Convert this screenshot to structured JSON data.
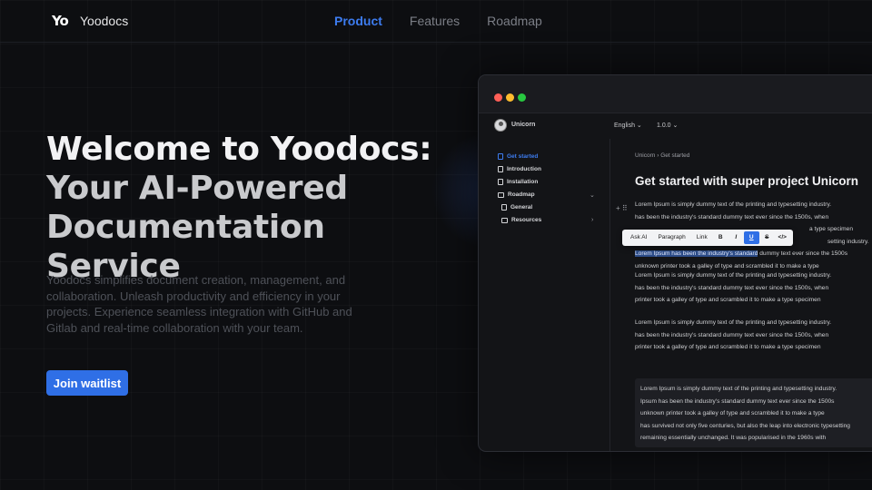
{
  "header": {
    "logo_mark": "Yo",
    "brand": "Yoodocs",
    "nav": [
      {
        "label": "Product",
        "active": true
      },
      {
        "label": "Features",
        "active": false
      },
      {
        "label": "Roadmap",
        "active": false
      }
    ]
  },
  "hero": {
    "title_line1": "Welcome to Yoodocs:",
    "title_line2": "Your AI-Powered",
    "title_line3": "Documentation Service",
    "description": "Yoodocs simplifies document creation, management, and collaboration. Unleash productivity and efficiency in your projects. Experience seamless integration with GitHub and Gitlab and real-time collaboration with your team.",
    "cta_label": "Join waitlist"
  },
  "app": {
    "project_name": "Unicorn",
    "language": "English",
    "version": "1.0.0",
    "sidebar": [
      {
        "label": "Get started",
        "icon": "doc-icon",
        "active": true
      },
      {
        "label": "Introduction",
        "icon": "doc-icon"
      },
      {
        "label": "Installation",
        "icon": "doc-icon"
      },
      {
        "label": "Roadmap",
        "icon": "folder-icon",
        "expanded": true
      },
      {
        "label": "General",
        "icon": "doc-icon"
      },
      {
        "label": "Resources",
        "icon": "folder-icon",
        "expanded": false
      }
    ],
    "breadcrumb": [
      "Unicorn",
      "Get started"
    ],
    "doc_title": "Get started with super project Unicorn",
    "para1": [
      "Lorem Ipsum is simply dummy text of the printing and typesetting industry.",
      "has been the industry's standard dummy text ever since the 1500s, when",
      "a type specimen",
      "setting industry."
    ],
    "para1_highlight": "Lorem Ipsum has been the industry's standard",
    "para1_after_highlight": " dummy text ever since the 1500s",
    "para1_last": "unknown printer took a galley of type and scrambled it to make a type",
    "toolbar": {
      "ask_ai": "Ask AI",
      "paragraph": "Paragraph",
      "link": "Link",
      "bold": "B",
      "italic": "I",
      "underline": "U",
      "strike": "S",
      "code": "</>"
    },
    "para2": [
      "Lorem Ipsum is simply dummy text of the printing and typesetting industry.",
      "has been the industry's standard dummy text ever since the 1500s, when",
      "printer took a galley of type and scrambled it to make a type specimen"
    ],
    "para3": [
      "Lorem Ipsum is simply dummy text of the printing and typesetting industry.",
      "has been the industry's standard dummy text ever since the 1500s, when",
      "printer took a galley of type and scrambled it to make a type specimen"
    ],
    "quote": [
      "Lorem Ipsum is simply dummy text of the printing and typesetting industry.",
      "Ipsum has been the industry's standard dummy text ever since the 1500s",
      "unknown printer took a galley of type and scrambled it to make a type",
      "has survived not only five centuries, but also the leap into electronic typesetting",
      "remaining essentially unchanged. It was popularised in the 1960s with"
    ]
  },
  "colors": {
    "accent": "#2f6fe6",
    "nav_active": "#3d7cf0",
    "background": "#0d0e11"
  }
}
